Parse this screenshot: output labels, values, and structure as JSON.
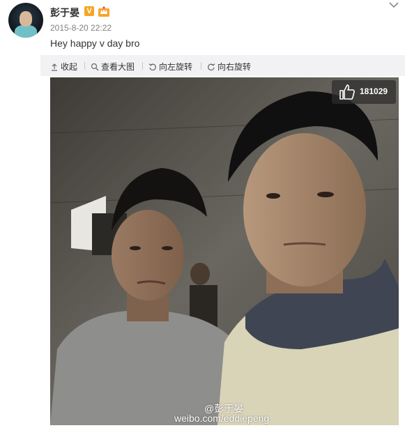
{
  "post": {
    "author_name": "彭于晏",
    "verified_badge": "V",
    "timestamp": "2015-8-20 22:22",
    "text": "Hey happy v day bro",
    "more_icon": "chevron-down-icon"
  },
  "toolbar": {
    "collapse_label": "收起",
    "view_large_label": "查看大图",
    "rotate_left_label": "向左旋转",
    "rotate_right_label": "向右旋转"
  },
  "photo": {
    "like_icon": "thumbs-up-icon",
    "like_count": "181029",
    "watermark_handle": "@彭于晏",
    "watermark_url": "weibo.com/eddiepeng"
  },
  "colors": {
    "toolbar_bg": "#f2f2f5",
    "verified_badge": "#f5a623",
    "timestamp": "#808080"
  }
}
